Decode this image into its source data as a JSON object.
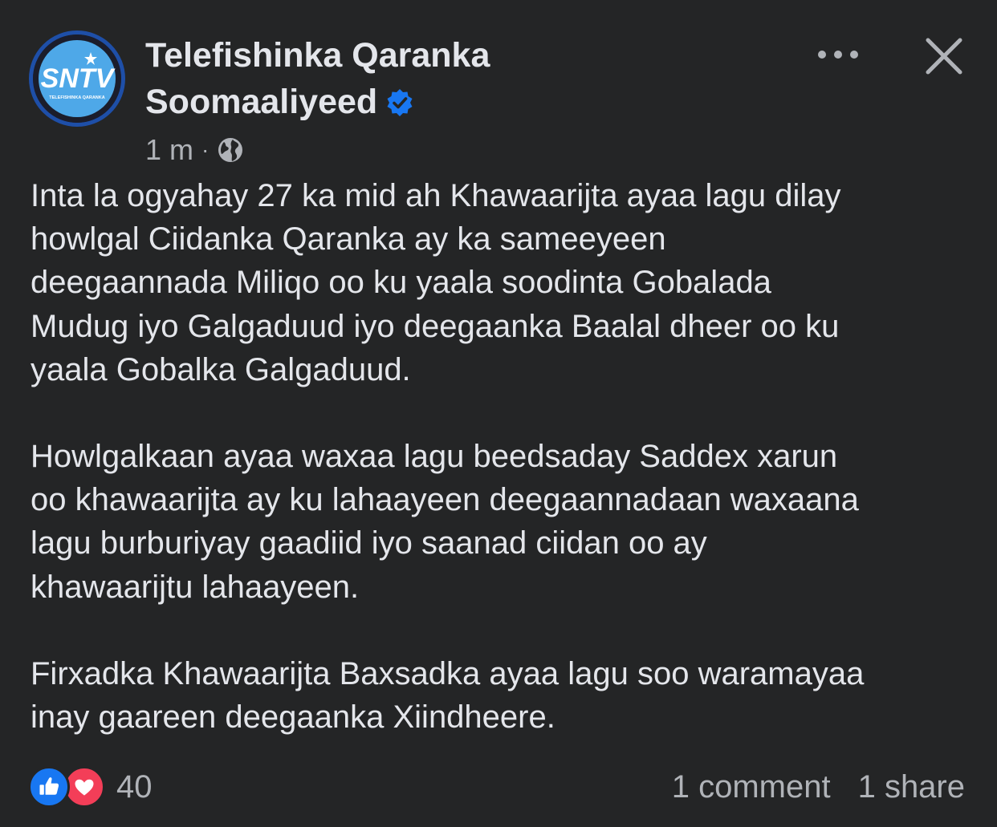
{
  "post": {
    "page_name_line1": "Telefishinka Qaranka",
    "page_name_line2": "Soomaaliyeed",
    "timestamp": "1 m",
    "separator": "·",
    "avatar": {
      "logo_text": "SNTV",
      "logo_subtext": "TELEFISHINKA QARANKA"
    },
    "body": {
      "p1": [
        "Inta la ogyahay 27 ka mid ah Khawaarijta ayaa lagu dilay",
        "howlgal Ciidanka Qaranka  ay ka sameeyeen",
        "deegaannada Miliqo oo ku yaala soodinta Gobalada",
        "Mudug iyo Galgaduud iyo deegaanka Baalal dheer oo ku",
        "yaala Gobalka Galgaduud."
      ],
      "p2": [
        "Howlgalkaan ayaa waxaa lagu beedsaday Saddex xarun",
        "oo khawaarijta ay ku lahaayeen deegaannadaan waxaana",
        "lagu burburiyay gaadiid iyo saanad ciidan oo ay",
        "khawaarijtu lahaayeen."
      ],
      "p3": [
        "Firxadka Khawaarijta Baxsadka ayaa lagu soo waramayaa",
        "inay gaareen deegaanka Xiindheere."
      ]
    },
    "reactions_count": "40",
    "comments": "1 comment",
    "shares": "1 share"
  },
  "icons": {
    "verified": "verified-badge-icon",
    "audience": "globe-icon",
    "more": "more-icon",
    "close": "close-icon",
    "like": "like-icon",
    "love": "love-icon"
  },
  "colors": {
    "background": "#242526",
    "text_primary": "#e4e6eb",
    "text_secondary": "#b0b3b8",
    "verified_blue": "#1877f2",
    "like_blue": "#1877f2",
    "love_red": "#f33e58",
    "avatar_ring": "#1e4fa8"
  }
}
